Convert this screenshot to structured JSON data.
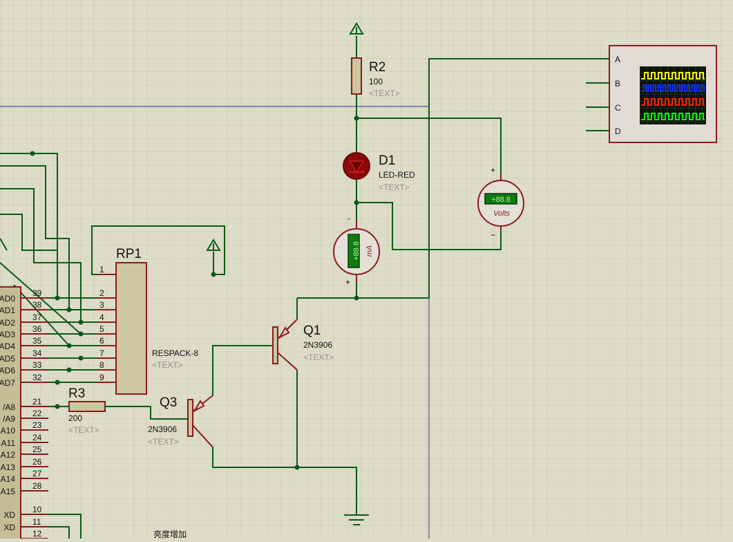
{
  "schematic": {
    "components": {
      "r2": {
        "ref": "R2",
        "value": "100",
        "text": "<TEXT>"
      },
      "d1": {
        "ref": "D1",
        "value": "LED-RED",
        "text": "<TEXT>"
      },
      "rp1": {
        "ref": "RP1",
        "value": "RESPACK-8",
        "text": "<TEXT>"
      },
      "q1": {
        "ref": "Q1",
        "value": "2N3906",
        "text": "<TEXT>"
      },
      "q3": {
        "ref": "Q3",
        "value": "2N3906",
        "text": "<TEXT>"
      },
      "r3": {
        "ref": "R3",
        "value": "200",
        "text": "<TEXT>"
      }
    },
    "ammeter": {
      "display": "+88.8",
      "unit": "mA",
      "plus": "+",
      "minus": "-"
    },
    "voltmeter": {
      "display": "+88.8",
      "unit": "Volts",
      "plus": "+",
      "minus": "−"
    },
    "oscilloscope": {
      "channels": [
        "A",
        "B",
        "C",
        "D"
      ],
      "trace_colors": [
        "#ffff00",
        "#1030ff",
        "#ff2000",
        "#00ff00"
      ]
    },
    "rp1_pins": [
      "1",
      "2",
      "3",
      "4",
      "5",
      "6",
      "7",
      "8",
      "9"
    ],
    "mcu_pins": [
      "39",
      "38",
      "37",
      "36",
      "35",
      "34",
      "33",
      "32",
      "21",
      "22",
      "23",
      "24",
      "25",
      "26",
      "27",
      "28",
      "10",
      "11",
      "12"
    ],
    "mcu_labels": [
      "AD0",
      "AD1",
      "AD2",
      "AD3",
      "AD4",
      "AD5",
      "AD6",
      "AD7",
      "/A8",
      "/A9",
      "A10",
      "A11",
      "A12",
      "A13",
      "A14",
      "A15",
      "XD",
      "XD"
    ],
    "note": "亮度增加"
  },
  "colors": {
    "background": "#dcdcc8",
    "grid": "#c8c8b4",
    "wire": "#0a5a14",
    "component": "#8b1a1a",
    "component_fill": "#cdc6a0",
    "mcu_fill": "#c5bd95",
    "led_fill": "#8b0a0a",
    "meter_fill": "#e4e0d8",
    "meter_display": "#0f7a0f",
    "meter_digits": "#aef0a0",
    "scope_fill": "#e0dcd4",
    "scope_screen": "#101010",
    "scope_grid": "#2a6a2a",
    "sheet_border": "#2020a0",
    "junction": "#0a5a14"
  },
  "icons": {
    "power_1": "power-terminal-icon",
    "power_2": "power-terminal-icon",
    "ground": "ground-icon"
  }
}
